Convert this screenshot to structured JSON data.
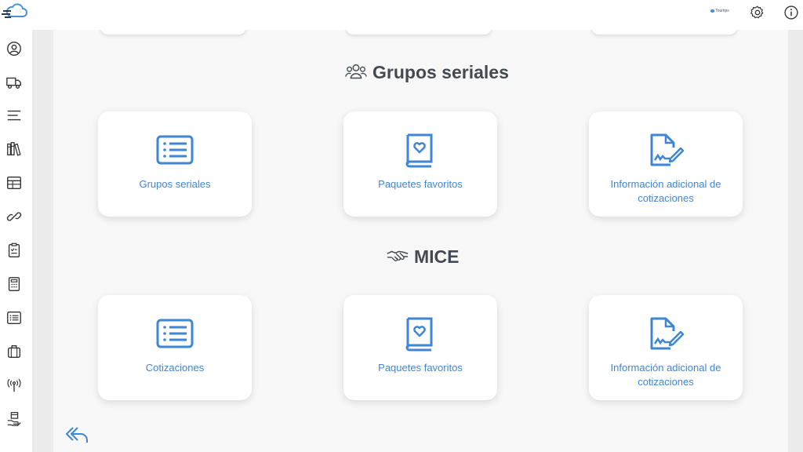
{
  "header": {
    "brand_text": "Tourtips",
    "accent": "#4a90d9"
  },
  "icons": {
    "logo": "cloud-logo-icon",
    "settings": "gear-icon",
    "info": "info-icon",
    "back": "reply-back-icon"
  },
  "sidebar": {
    "items": [
      {
        "icon": "user-circle-icon"
      },
      {
        "icon": "truck-icon"
      },
      {
        "icon": "menu-lines-icon"
      },
      {
        "icon": "books-icon"
      },
      {
        "icon": "table-icon"
      },
      {
        "icon": "link-icon"
      },
      {
        "icon": "clipboard-check-icon"
      },
      {
        "icon": "calculator-icon"
      },
      {
        "icon": "list-icon"
      },
      {
        "icon": "suitcase-icon"
      },
      {
        "icon": "antenna-icon"
      },
      {
        "icon": "hand-box-icon"
      }
    ]
  },
  "sections": [
    {
      "title": "Grupos seriales",
      "icon": "group-users-icon",
      "cards": [
        {
          "label": "Grupos seriales",
          "icon": "list-icon"
        },
        {
          "label": "Paquetes favoritos",
          "icon": "heart-book-icon"
        },
        {
          "label": "Información adicional de cotizaciones",
          "icon": "signed-document-icon"
        }
      ]
    },
    {
      "title": "MICE",
      "icon": "handshake-icon",
      "cards": [
        {
          "label": "Cotizaciones",
          "icon": "list-icon"
        },
        {
          "label": "Paquetes favoritos",
          "icon": "heart-book-icon"
        },
        {
          "label": "Información adicional de cotizaciones",
          "icon": "signed-document-icon"
        }
      ]
    }
  ]
}
